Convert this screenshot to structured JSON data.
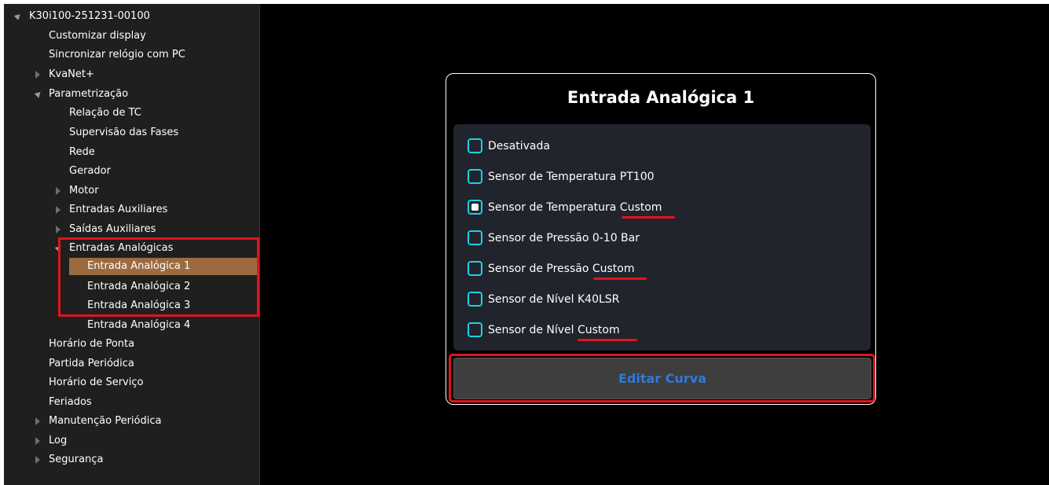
{
  "sidebar": {
    "root": "K30i100-251231-00100",
    "items": {
      "customizar": "Customizar display",
      "sincronizar": "Sincronizar relógio com PC",
      "kvanet": "KvaNet+",
      "parametrizacao": "Parametrização",
      "relacao_tc": "Relação de TC",
      "supervisao": "Supervisão das Fases",
      "rede": "Rede",
      "gerador": "Gerador",
      "motor": "Motor",
      "entradas_aux": "Entradas Auxiliares",
      "saidas_aux": "Saídas Auxiliares",
      "entradas_analogicas": "Entradas Analógicas",
      "ea1": "Entrada Analógica 1",
      "ea2": "Entrada Analógica 2",
      "ea3": "Entrada Analógica 3",
      "ea4": "Entrada Analógica 4",
      "horario_ponta": "Horário de Ponta",
      "partida": "Partida Periódica",
      "horario_servico": "Horário de Serviço",
      "feriados": "Feriados",
      "manutencao": "Manutenção Periódica",
      "log": "Log",
      "seguranca": "Segurança"
    },
    "selected": "Entrada Analógica 1",
    "selected_color": "#9b6b3f"
  },
  "panel": {
    "title": "Entrada Analógica 1",
    "options": [
      {
        "label": "Desativada",
        "checked": false
      },
      {
        "label": "Sensor de Temperatura PT100",
        "checked": false
      },
      {
        "label": "Sensor de Temperatura Custom",
        "checked": true
      },
      {
        "label": "Sensor de Pressão 0-10 Bar",
        "checked": false
      },
      {
        "label": "Sensor de Pressão Custom",
        "checked": false
      },
      {
        "label": "Sensor de Nível K40LSR",
        "checked": false
      },
      {
        "label": "Sensor de Nível Custom",
        "checked": false
      }
    ],
    "edit_button": "Editar Curva"
  },
  "colors": {
    "accent_radio": "#18d3e4",
    "annotation_red": "#e2141c",
    "button_text": "#2f7ad8"
  }
}
